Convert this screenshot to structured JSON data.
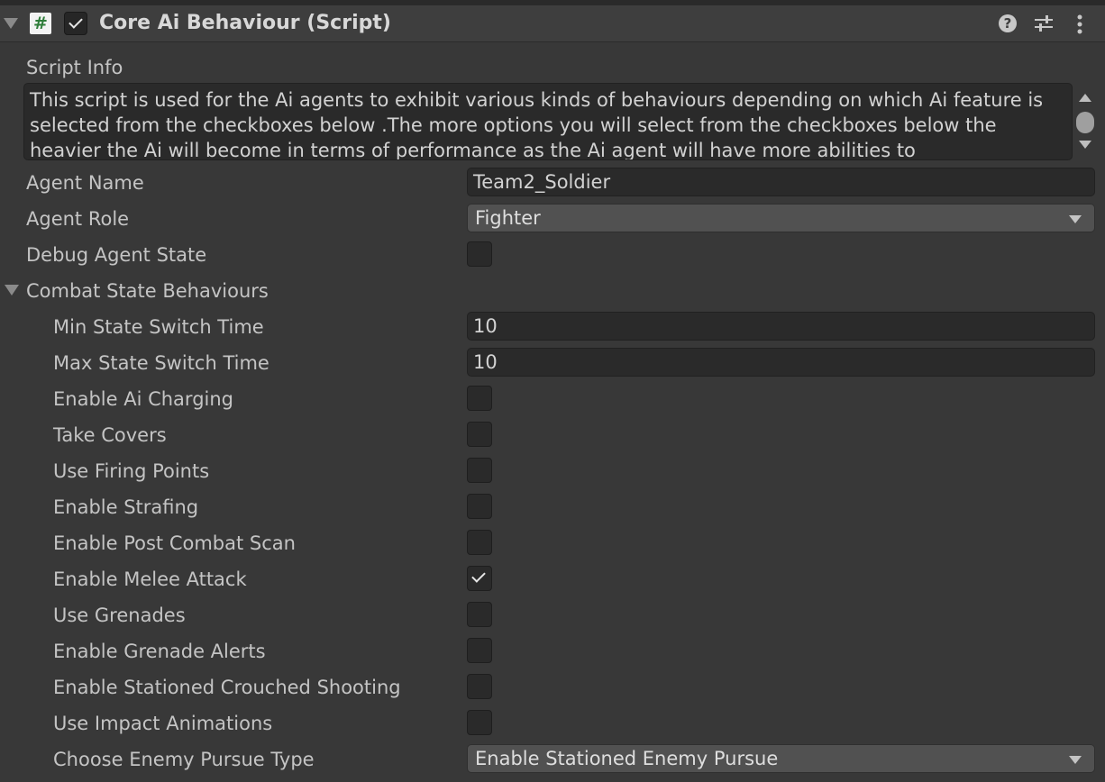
{
  "component": {
    "title": "Core Ai Behaviour (Script)",
    "script_icon_glyph": "#",
    "enabled": true,
    "icons": [
      "help-icon",
      "preset-icon",
      "more-menu-icon"
    ]
  },
  "script_info": {
    "label": "Script Info",
    "text": "This script is used for the Ai agents to exhibit various kinds of behaviours depending on which Ai feature is selected from the checkboxes below .The more options you will select from the checkboxes below the heavier the Ai will become in terms of performance as the Ai agent will have more abilities to"
  },
  "agent_name": {
    "label": "Agent Name",
    "value": "Team2_Soldier"
  },
  "agent_role": {
    "label": "Agent Role",
    "value": "Fighter"
  },
  "debug_agent_state": {
    "label": "Debug Agent State",
    "checked": false
  },
  "combat": {
    "label": "Combat State Behaviours",
    "expanded": true,
    "min_switch": {
      "label": "Min State Switch Time",
      "value": "10"
    },
    "max_switch": {
      "label": "Max State Switch Time",
      "value": "10"
    },
    "toggles": [
      {
        "label": "Enable Ai Charging",
        "checked": false
      },
      {
        "label": "Take Covers",
        "checked": false
      },
      {
        "label": "Use Firing Points",
        "checked": false
      },
      {
        "label": "Enable Strafing",
        "checked": false
      },
      {
        "label": "Enable Post Combat Scan",
        "checked": false
      },
      {
        "label": "Enable Melee Attack",
        "checked": true
      },
      {
        "label": "Use Grenades",
        "checked": false
      },
      {
        "label": "Enable Grenade Alerts",
        "checked": false
      },
      {
        "label": "Enable Stationed Crouched Shooting",
        "checked": false
      },
      {
        "label": "Use Impact Animations",
        "checked": false
      }
    ],
    "pursue": {
      "label": "Choose Enemy Pursue Type",
      "value": "Enable Stationed Enemy Pursue"
    }
  }
}
